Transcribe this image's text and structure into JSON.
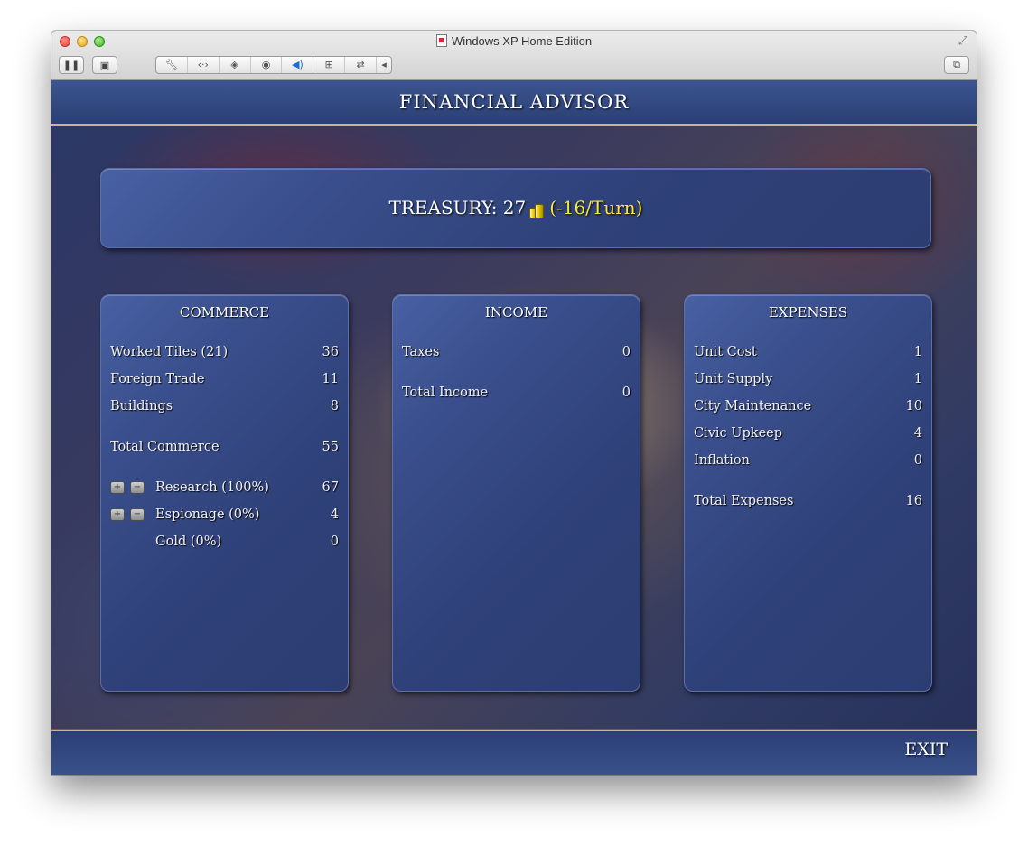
{
  "window": {
    "title": "Windows XP Home Edition",
    "toolbar_icons": [
      "pause-icon",
      "screenshot-icon",
      "wrench-icon",
      "network-icon",
      "disk-icon",
      "cd-icon",
      "sound-icon",
      "usb-icon",
      "sharing-icon",
      "collapse-icon",
      "restore-icon"
    ]
  },
  "screen": {
    "title": "FINANCIAL ADVISOR",
    "exit_label": "EXIT"
  },
  "treasury": {
    "label": "TREASURY: 27",
    "rate": "(-16/Turn)",
    "rate_color": "#f6ea3c"
  },
  "commerce": {
    "title": "COMMERCE",
    "rows": [
      {
        "label": "Worked Tiles (21)",
        "value": "36"
      },
      {
        "label": "Foreign Trade",
        "value": "11"
      },
      {
        "label": "Buildings",
        "value": "8"
      },
      {
        "label": "Total Commerce",
        "value": "55"
      },
      {
        "label": "Research (100%)",
        "value": "67"
      },
      {
        "label": "Espionage (0%)",
        "value": "4"
      },
      {
        "label": "Gold (0%)",
        "value": "0"
      }
    ]
  },
  "income": {
    "title": "INCOME",
    "rows": [
      {
        "label": "Taxes",
        "value": "0"
      },
      {
        "label": "Total Income",
        "value": "0"
      }
    ]
  },
  "expenses": {
    "title": "EXPENSES",
    "rows": [
      {
        "label": "Unit Cost",
        "value": "1"
      },
      {
        "label": "Unit Supply",
        "value": "1"
      },
      {
        "label": "City Maintenance",
        "value": "10"
      },
      {
        "label": "Civic Upkeep",
        "value": "4"
      },
      {
        "label": "Inflation",
        "value": "0"
      },
      {
        "label": "Total Expenses",
        "value": "16"
      }
    ]
  },
  "controls": {
    "increase": "+",
    "decrease": "−"
  }
}
